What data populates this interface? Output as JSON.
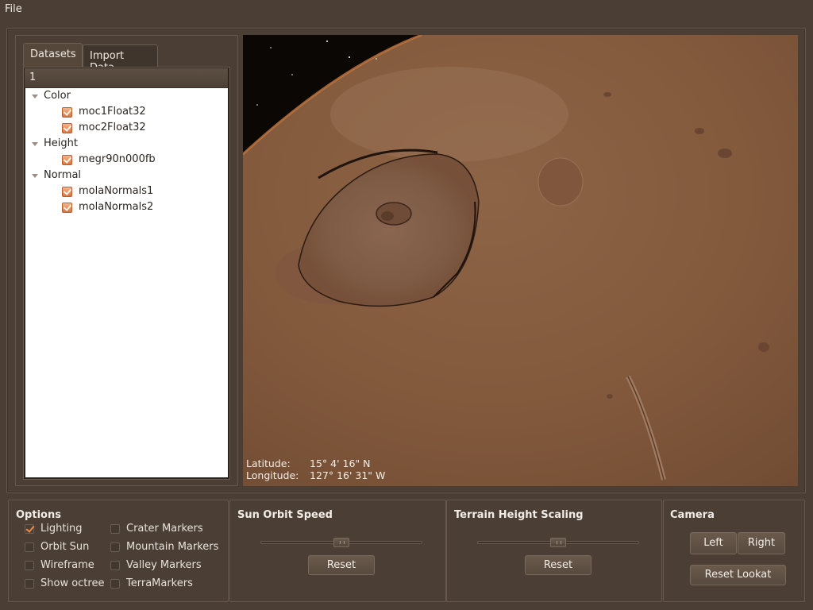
{
  "menu": {
    "file": "File"
  },
  "tabs": {
    "datasets": "Datasets",
    "import": "Import Data"
  },
  "tree": {
    "header": "1",
    "groups": [
      {
        "label": "Color",
        "items": [
          "moc1Float32",
          "moc2Float32"
        ]
      },
      {
        "label": "Height",
        "items": [
          "megr90n000fb"
        ]
      },
      {
        "label": "Normal",
        "items": [
          "molaNormals1",
          "molaNormals2"
        ]
      }
    ]
  },
  "coords": {
    "lat_label": "Latitude:",
    "lat_value": "15° 4' 16\" N",
    "lon_label": "Longitude:",
    "lon_value": "127° 16' 31\" W"
  },
  "options": {
    "title": "Options",
    "items": [
      {
        "label": "Lighting",
        "checked": true
      },
      {
        "label": "Orbit Sun",
        "checked": false
      },
      {
        "label": "Wireframe",
        "checked": false
      },
      {
        "label": "Show octree",
        "checked": false
      },
      {
        "label": "Crater Markers",
        "checked": false
      },
      {
        "label": "Mountain Markers",
        "checked": false
      },
      {
        "label": "Valley Markers",
        "checked": false
      },
      {
        "label": "TerraMarkers",
        "checked": false
      }
    ]
  },
  "sun_orbit": {
    "title": "Sun Orbit Speed",
    "reset": "Reset",
    "value": 0.5
  },
  "terrain": {
    "title": "Terrain Height Scaling",
    "reset": "Reset",
    "value": 0.5
  },
  "camera": {
    "title": "Camera",
    "left": "Left",
    "right": "Right",
    "reset_lookat": "Reset Lookat"
  },
  "colors": {
    "accent": "#e07a40",
    "background": "#4a3e35",
    "mars": "#8a5c40"
  }
}
